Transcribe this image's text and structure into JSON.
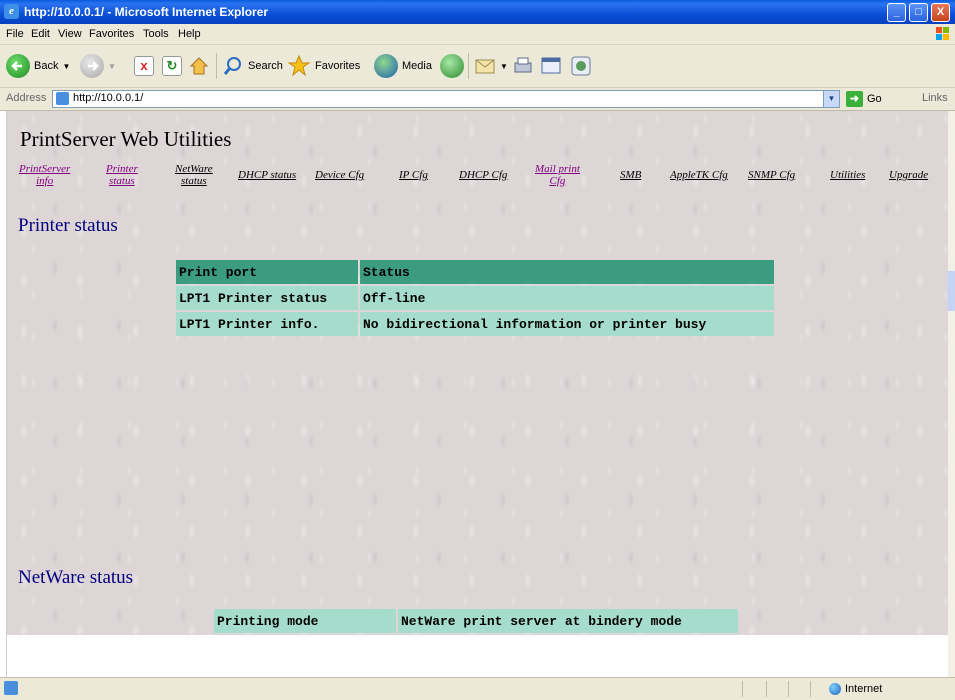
{
  "window": {
    "title": "http://10.0.0.1/ - Microsoft Internet Explorer",
    "controls": {
      "minimize": "_",
      "maximize": "□",
      "close": "X"
    }
  },
  "menu": [
    "File",
    "Edit",
    "View",
    "Favorites",
    "Tools",
    "Help"
  ],
  "toolbar": {
    "back": "Back",
    "search": "Search",
    "favorites": "Favorites",
    "media": "Media"
  },
  "address": {
    "label": "Address",
    "url": "http://10.0.0.1/",
    "go": "Go",
    "links": "Links"
  },
  "page": {
    "title": "PrintServer Web Utilities",
    "nav": [
      {
        "label_line1": "PrintServer",
        "label_line2": "info",
        "visited": true
      },
      {
        "label_line1": "Printer",
        "label_line2": "status",
        "visited": true
      },
      {
        "label_line1": "NetWare",
        "label_line2": "status",
        "visited": false
      },
      {
        "label_line1": "DHCP status",
        "label_line2": "",
        "visited": false
      },
      {
        "label_line1": "Device Cfg",
        "label_line2": "",
        "visited": false
      },
      {
        "label_line1": "IP Cfg",
        "label_line2": "",
        "visited": false
      },
      {
        "label_line1": "DHCP Cfg",
        "label_line2": "",
        "visited": false
      },
      {
        "label_line1": "Mail print",
        "label_line2": "Cfg",
        "visited": true
      },
      {
        "label_line1": "SMB",
        "label_line2": "",
        "visited": false
      },
      {
        "label_line1": "AppleTK Cfg",
        "label_line2": "",
        "visited": false
      },
      {
        "label_line1": "SNMP Cfg",
        "label_line2": "",
        "visited": false
      },
      {
        "label_line1": "Utilities",
        "label_line2": "",
        "visited": false
      },
      {
        "label_line1": "Upgrade",
        "label_line2": "",
        "visited": false
      }
    ],
    "printer_status": {
      "heading": "Printer status",
      "header": [
        "Print port",
        "Status"
      ],
      "rows": [
        [
          "LPT1 Printer status",
          "Off-line"
        ],
        [
          "LPT1 Printer info.",
          "No bidirectional information or printer busy"
        ]
      ]
    },
    "netware_status": {
      "heading": "NetWare status",
      "rows": [
        [
          "Printing mode",
          "NetWare print server at bindery mode"
        ]
      ]
    }
  },
  "statusbar": {
    "zone": "Internet"
  },
  "colors": {
    "table_header": "#3c9c80",
    "table_row": "#a6dccc",
    "heading": "#000080",
    "visited_link": "#800080"
  }
}
